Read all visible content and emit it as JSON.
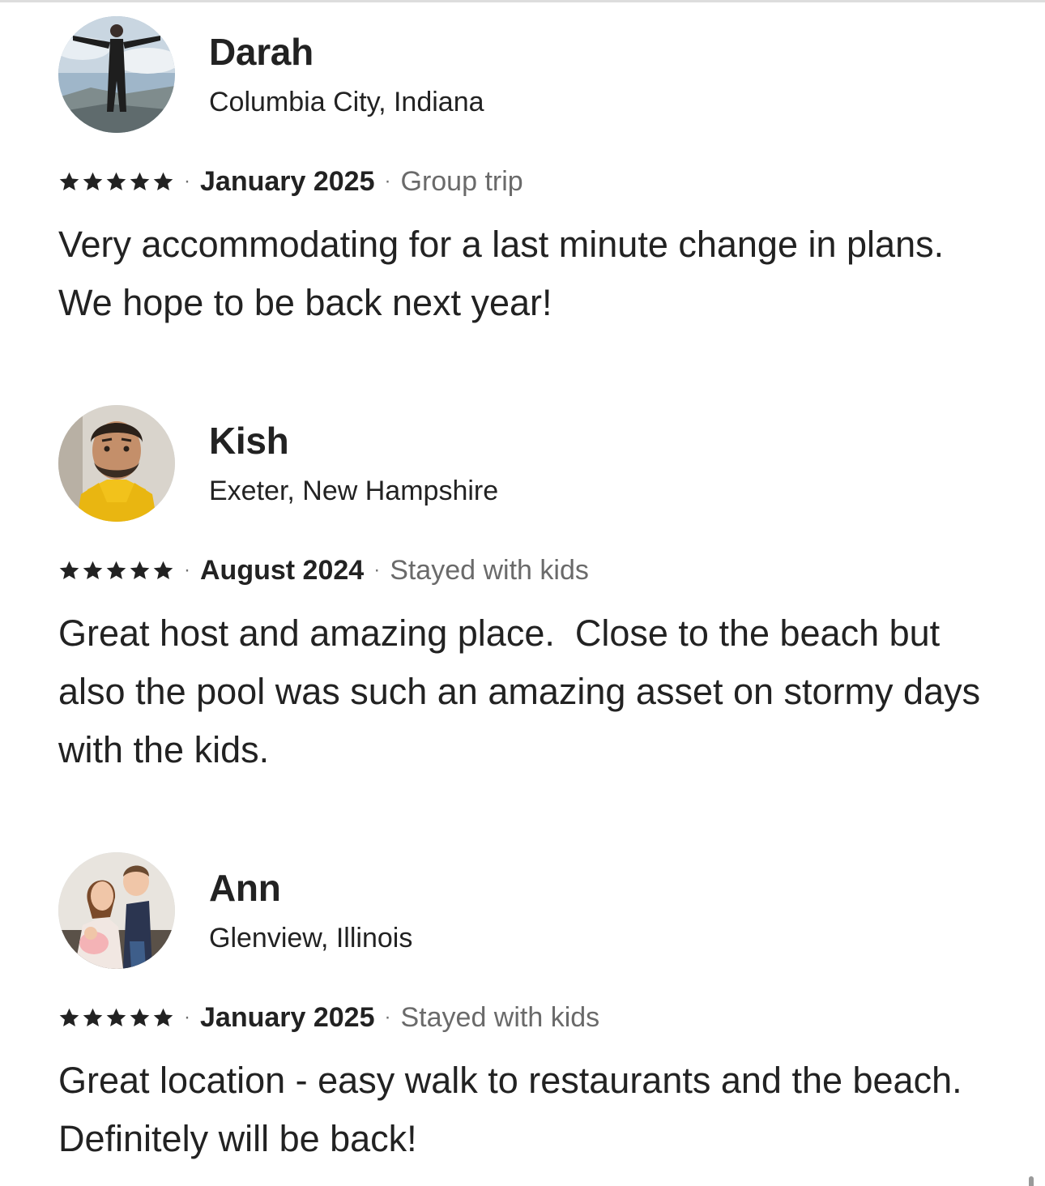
{
  "reviews": [
    {
      "name": "Darah",
      "location": "Columbia City, Indiana",
      "rating": 5,
      "date": "January 2025",
      "trip_type": "Group trip",
      "text": "Very accommodating for a last minute change in plans. We hope to be back next year!",
      "avatar": "person-jumping-photo"
    },
    {
      "name": "Kish",
      "location": "Exeter, New Hampshire",
      "rating": 5,
      "date": "August 2024",
      "trip_type": "Stayed with kids",
      "text": "Great host and amazing place.  Close to the beach but also the pool was such an amazing asset on stormy days with the kids.",
      "avatar": "man-yellow-hoodie-photo"
    },
    {
      "name": "Ann",
      "location": "Glenview, Illinois",
      "rating": 5,
      "date": "January 2025",
      "trip_type": "Stayed with kids",
      "text": "Great location - easy walk to restaurants and the beach. Definitely will be back!",
      "avatar": "mother-with-kids-photo"
    }
  ],
  "separator": "·",
  "icons": {
    "star": "star-icon"
  },
  "colors": {
    "text": "#222222",
    "secondary": "#6a6a6a"
  }
}
